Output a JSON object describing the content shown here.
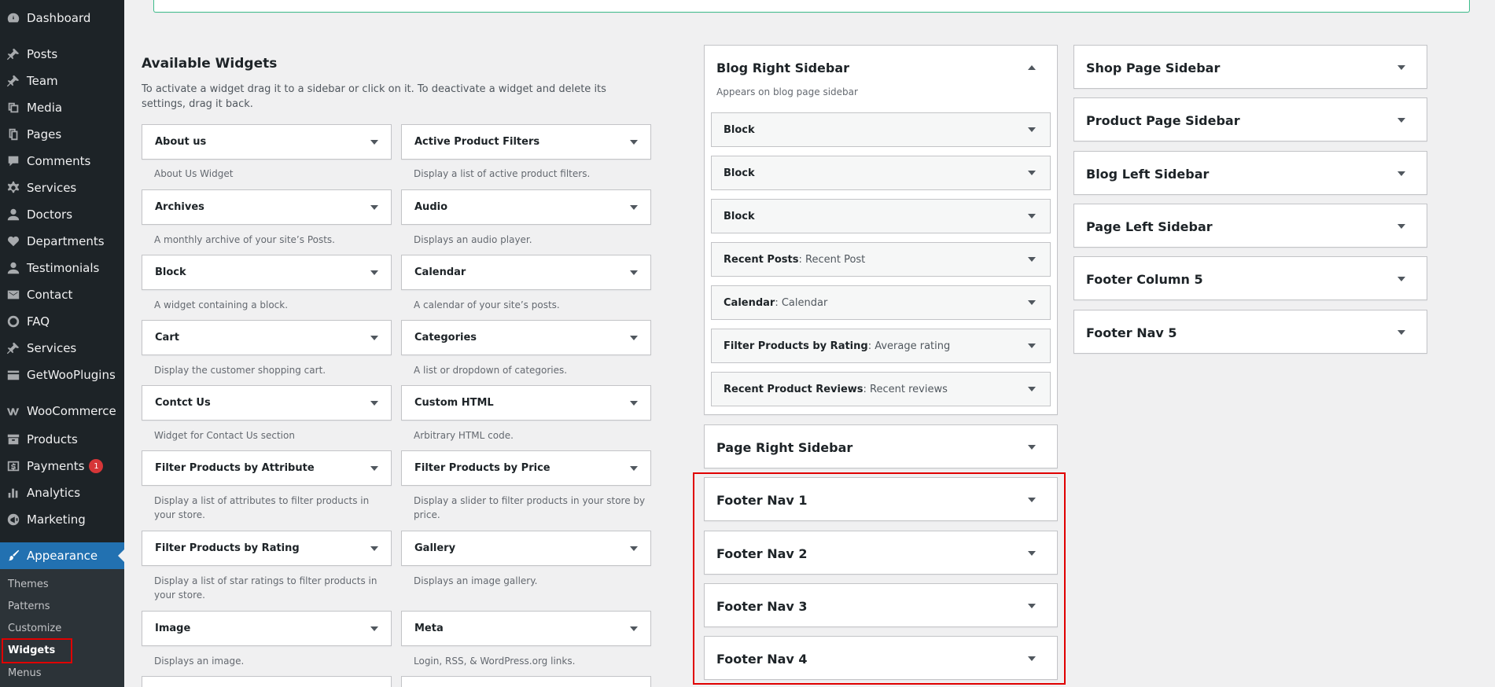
{
  "menu": {
    "items": [
      {
        "label": "Dashboard",
        "icon": "dashboard-icon"
      },
      {
        "label": "Posts",
        "icon": "pin-icon"
      },
      {
        "label": "Team",
        "icon": "pin-icon"
      },
      {
        "label": "Media",
        "icon": "media-icon"
      },
      {
        "label": "Pages",
        "icon": "pages-icon"
      },
      {
        "label": "Comments",
        "icon": "comment-icon"
      },
      {
        "label": "Services",
        "icon": "gear-icon"
      },
      {
        "label": "Doctors",
        "icon": "user-icon"
      },
      {
        "label": "Departments",
        "icon": "heart-icon"
      },
      {
        "label": "Testimonials",
        "icon": "user-icon"
      },
      {
        "label": "Contact",
        "icon": "email-icon"
      },
      {
        "label": "FAQ",
        "icon": "circle-icon"
      },
      {
        "label": "Services",
        "icon": "pin-icon"
      },
      {
        "label": "GetWooPlugins",
        "icon": "grid-icon"
      },
      {
        "label": "WooCommerce",
        "icon": "woo-icon"
      },
      {
        "label": "Products",
        "icon": "archive-icon"
      },
      {
        "label": "Payments",
        "icon": "dollar-icon",
        "badge": "1"
      },
      {
        "label": "Analytics",
        "icon": "chart-icon"
      },
      {
        "label": "Marketing",
        "icon": "megaphone-icon"
      },
      {
        "label": "Appearance",
        "icon": "brush-icon"
      }
    ],
    "submenu": [
      "Themes",
      "Patterns",
      "Customize",
      "Widgets",
      "Menus"
    ]
  },
  "available": {
    "title": "Available Widgets",
    "description": "To activate a widget drag it to a sidebar or click on it. To deactivate a widget and delete its settings, drag it back.",
    "widgets": [
      {
        "title": "About us",
        "desc": "About Us Widget"
      },
      {
        "title": "Active Product Filters",
        "desc": "Display a list of active product filters."
      },
      {
        "title": "Archives",
        "desc": "A monthly archive of your site’s Posts."
      },
      {
        "title": "Audio",
        "desc": "Displays an audio player."
      },
      {
        "title": "Block",
        "desc": "A widget containing a block."
      },
      {
        "title": "Calendar",
        "desc": "A calendar of your site’s posts."
      },
      {
        "title": "Cart",
        "desc": "Display the customer shopping cart."
      },
      {
        "title": "Categories",
        "desc": "A list or dropdown of categories."
      },
      {
        "title": "Contct Us",
        "desc": "Widget for Contact Us section"
      },
      {
        "title": "Custom HTML",
        "desc": "Arbitrary HTML code."
      },
      {
        "title": "Filter Products by Attribute",
        "desc": "Display a list of attributes to filter products in your store."
      },
      {
        "title": "Filter Products by Price",
        "desc": "Display a slider to filter products in your store by price."
      },
      {
        "title": "Filter Products by Rating",
        "desc": "Display a list of star ratings to filter products in your store."
      },
      {
        "title": "Gallery",
        "desc": "Displays an image gallery."
      },
      {
        "title": "Image",
        "desc": "Displays an image."
      },
      {
        "title": "Meta",
        "desc": "Login, RSS, & WordPress.org links."
      }
    ]
  },
  "blog_right": {
    "title": "Blog Right Sidebar",
    "description": "Appears on blog page sidebar",
    "widgets": [
      {
        "title": "Block",
        "sub": ""
      },
      {
        "title": "Block",
        "sub": ""
      },
      {
        "title": "Block",
        "sub": ""
      },
      {
        "title": "Recent Posts",
        "sub": ": Recent Post"
      },
      {
        "title": "Calendar",
        "sub": ": Calendar"
      },
      {
        "title": "Filter Products by Rating",
        "sub": ": Average rating"
      },
      {
        "title": "Recent Product Reviews",
        "sub": ": Recent reviews"
      }
    ]
  },
  "middle_sidebars": [
    "Page Right Sidebar",
    "Footer Nav 1",
    "Footer Nav 2",
    "Footer Nav 3",
    "Footer Nav 4"
  ],
  "right_sidebars": [
    "Shop Page Sidebar",
    "Product Page Sidebar",
    "Blog Left Sidebar",
    "Page Left Sidebar",
    "Footer Column 5",
    "Footer Nav 5"
  ],
  "colors": {
    "accent": "#2271b1",
    "highlight": "#e00000",
    "notice_border": "#3dbd8c"
  }
}
